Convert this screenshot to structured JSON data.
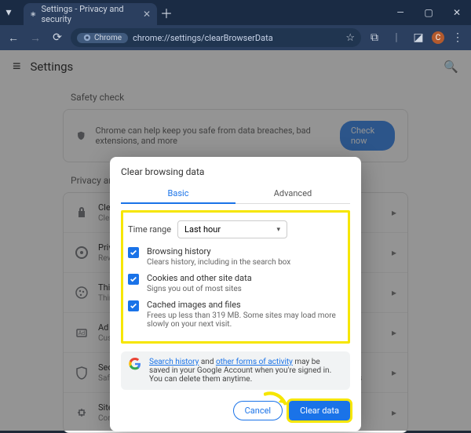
{
  "window": {
    "tab_title": "Settings - Privacy and security",
    "new_tab_glyph": "＋",
    "min_glyph": "—",
    "max_glyph": "▢",
    "close_glyph": "✕"
  },
  "addressbar": {
    "back_glyph": "←",
    "fwd_glyph": "→",
    "reload_glyph": "⟳",
    "chip_label": "Chrome",
    "url": "chrome://settings/clearBrowserData",
    "star_glyph": "☆",
    "ext_glyph": "⧉",
    "panel_glyph": "◪",
    "menu_glyph": "⋮",
    "profile_letter": "C"
  },
  "page": {
    "hamburger_glyph": "≡",
    "title": "Settings",
    "search_glyph": "🔍",
    "safety": {
      "heading": "Safety check",
      "text": "Chrome can help keep you safe from data breaches, bad extensions, and more",
      "button": "Check now"
    },
    "privacy": {
      "heading": "Privacy and security",
      "rows": [
        {
          "title": "Clear browsing data",
          "sub": "Clear history, cookies, cache, and more"
        },
        {
          "title": "Privacy Guide",
          "sub": "Review key privacy and security controls"
        },
        {
          "title": "Third-party cookies",
          "sub": "Third-party cookies are blocked in Incognito mode"
        },
        {
          "title": "Ad privacy",
          "sub": "Customize the info used by sites to show you ads"
        },
        {
          "title": "Security",
          "sub": "Safe Browsing (protection from dangerous sites) and other security settings"
        },
        {
          "title": "Site settings",
          "sub": "Controls what information sites can use and show"
        }
      ],
      "chev": "▸"
    }
  },
  "dialog": {
    "title": "Clear browsing data",
    "tab_basic": "Basic",
    "tab_advanced": "Advanced",
    "time_range_label": "Time range",
    "time_range_value": "Last hour",
    "caret": "▾",
    "items": [
      {
        "title": "Browsing history",
        "sub": "Clears history, including in the search box"
      },
      {
        "title": "Cookies and other site data",
        "sub": "Signs you out of most sites"
      },
      {
        "title": "Cached images and files",
        "sub": "Frees up less than 319 MB. Some sites may load more slowly on your next visit."
      }
    ],
    "info_link1": "Search history",
    "info_mid": " and ",
    "info_link2": "other forms of activity",
    "info_rest": " may be saved in your Google Account when you're signed in. You can delete them anytime.",
    "cancel": "Cancel",
    "clear": "Clear data"
  }
}
